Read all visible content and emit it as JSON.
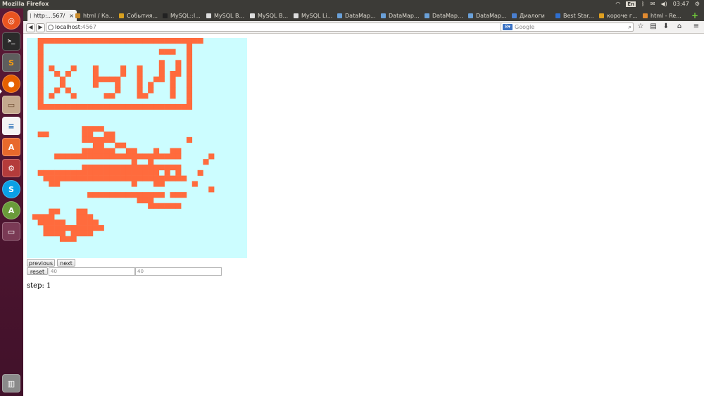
{
  "window": {
    "title": "Mozilla Firefox"
  },
  "tray": {
    "lang": "En",
    "time": "03:47"
  },
  "tabs": [
    {
      "label": "http:...567/",
      "active": true,
      "fav_color": "#888888"
    },
    {
      "label": "html / Ка...",
      "fav_color": "#c98a2a"
    },
    {
      "label": "События...",
      "fav_color": "#d8a020"
    },
    {
      "label": "MySQL::I...",
      "fav_color": "#222222"
    },
    {
      "label": "MySQL B...",
      "fav_color": "#dddddd"
    },
    {
      "label": "MySQL B...",
      "fav_color": "#dddddd"
    },
    {
      "label": "MySQL Li...",
      "fav_color": "#dddddd"
    },
    {
      "label": "DataMap...",
      "fav_color": "#6aa0d8"
    },
    {
      "label": "DataMap...",
      "fav_color": "#6aa0d8"
    },
    {
      "label": "DataMap...",
      "fav_color": "#6aa0d8"
    },
    {
      "label": "DataMap...",
      "fav_color": "#6aa0d8"
    },
    {
      "label": "Диалоги",
      "fav_color": "#4a7fcf"
    },
    {
      "label": "Best Star...",
      "fav_color": "#2f6fd0"
    },
    {
      "label": "короче г...",
      "fav_color": "#e0a020"
    },
    {
      "label": "html - Re...",
      "fav_color": "#e08a30"
    }
  ],
  "nav": {
    "url_host": "localhost",
    "url_port": ":4567",
    "search_placeholder": "Google"
  },
  "launcher": {
    "items": [
      "ubuntu-home",
      "terminal",
      "sublime-text",
      "firefox",
      "files",
      "writer",
      "software-center",
      "system-settings",
      "skype",
      "update-manager",
      "workspace",
      "trash"
    ]
  },
  "page": {
    "previous_label": "previous",
    "next_label": "next",
    "reset_label": "reset",
    "width_value": "40",
    "height_value": "40",
    "step_label": "step:",
    "step_value": "1"
  },
  "colors": {
    "canvas_bg": "#ccfdff",
    "pixel": "#ff6b3d"
  },
  "pixel_grid": {
    "cols": 40,
    "rows": 40,
    "rows_data": [
      "..------------------------------........",
      "..-..........................-..........",
      "..-.....................---..-..........",
      "..-..........................-..........",
      "..-.....................-..-.-..........",
      "..-.-...-...-....-..-...-..-.-..........",
      "..-..-.-....-....-..-...-.--.-..........",
      "..-...-.....-----...-..--.-..-..........",
      "..-...-.....-...-...-.-...-..-..........",
      "..-..-.-........-...-.-...-..-..........",
      "..-.-...-.....--....--....-..-..........",
      "..-..........................-..........",
      "..----------------------------..........",
      "........................................",
      "........................................",
      "........................................",
      "..........----..........................",
      "..--......--..--........................",
      "..........------.............-..........",
      "............--..--.......................",
      "..........------..--...-..--............",
      ".....-----------------------.....-......",
      "...................-..-.........-......",
      "..........------------------.........",
      "..----------------------.-.-...-.......",
      "...--------------------------..........",
      "....--.............-...--.....-.........",
      ".................................-......",
      "...........--------------.---...........",
      "....................---..................",
      "......................------...........",
      "....--...--........................",
      ".----....---.......................",
      "..-----..----.......................",
      "...-----------.......................",
      "...----.----.........................",
      "......---............................",
      "........................................",
      "........................................",
      "........................................"
    ]
  }
}
